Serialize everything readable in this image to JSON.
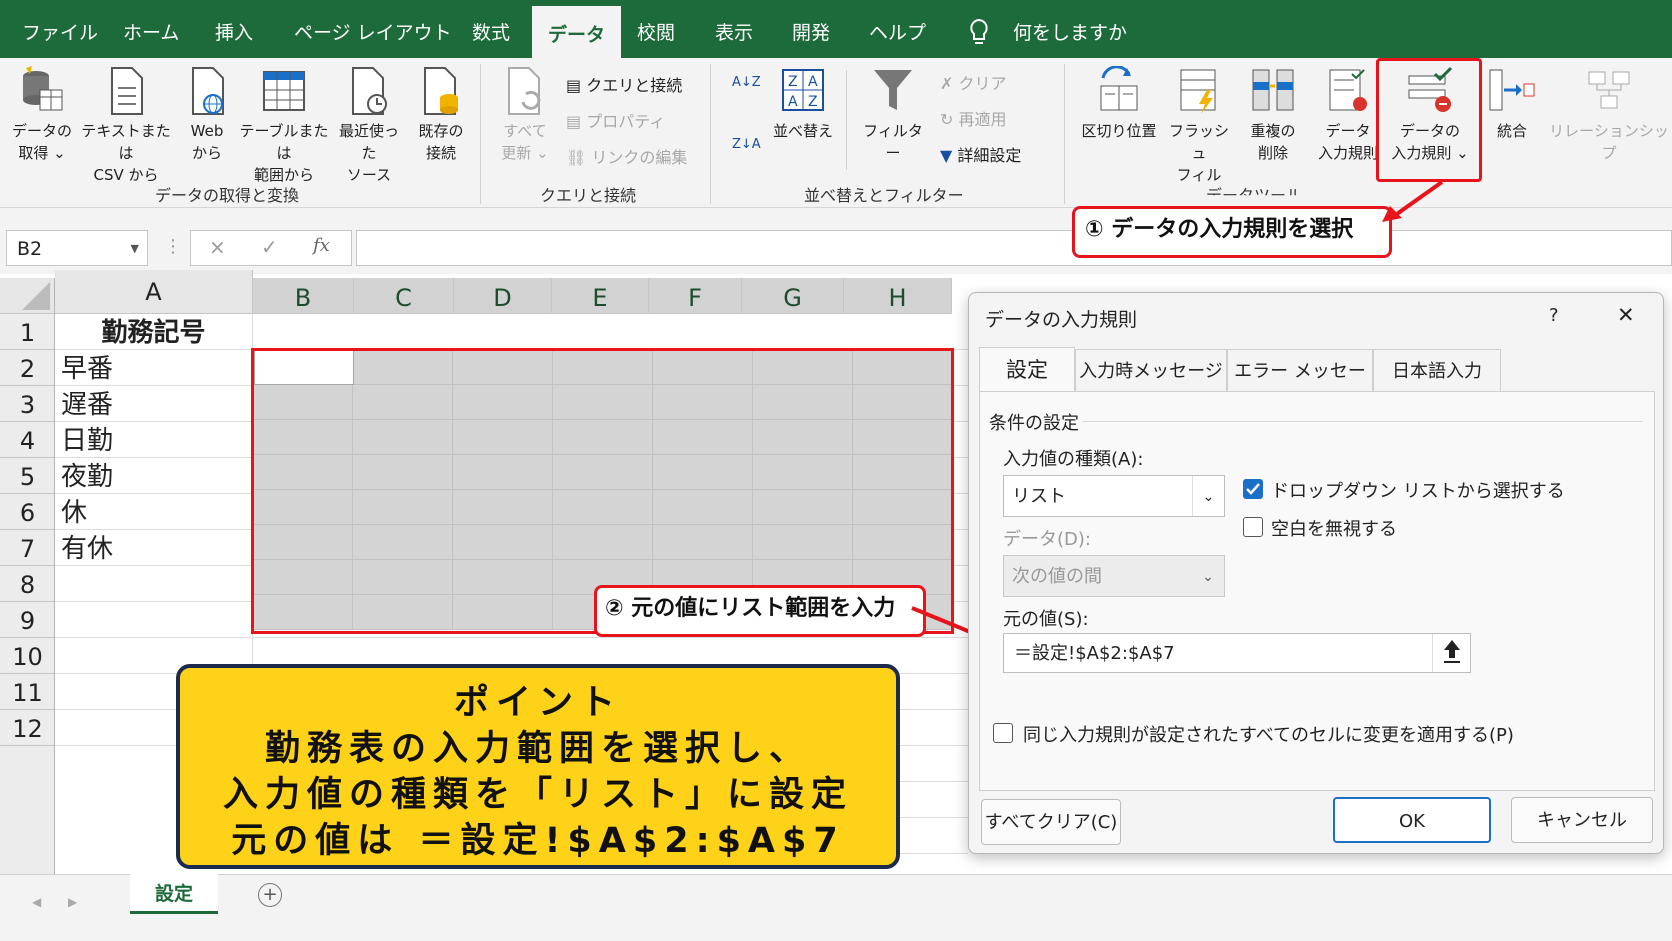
{
  "menu": {
    "tabs": [
      "ファイル",
      "ホーム",
      "挿入",
      "ページ レイアウト",
      "数式",
      "データ",
      "校閲",
      "表示",
      "開発",
      "ヘルプ"
    ],
    "active_tab": "データ",
    "tell_me": "何をしますか"
  },
  "ribbon": {
    "get_data": {
      "line1": "データの",
      "line2": "取得 ⌄"
    },
    "text_csv": {
      "line1": "テキストまたは",
      "line2": "CSV から"
    },
    "web": {
      "line1": "Web",
      "line2": "から"
    },
    "table_range": {
      "line1": "テーブルまたは",
      "line2": "範囲から"
    },
    "recent": {
      "line1": "最近使った",
      "line2": "ソース"
    },
    "existing": {
      "line1": "既存の",
      "line2": "接続"
    },
    "group1": "データの取得と変換",
    "refresh_all": {
      "line1": "すべて",
      "line2": "更新 ⌄"
    },
    "queries_conn": "クエリと接続",
    "properties": "プロパティ",
    "edit_links": "リンクの編集",
    "group2": "クエリと接続",
    "sort_az": "A↓Z",
    "sort_za": "Z↓A",
    "sort": "並べ替え",
    "filter": "フィルター",
    "clear": "クリア",
    "reapply": "再適用",
    "advanced": "詳細設定",
    "group3": "並べ替えとフィルター",
    "text_to_cols": "区切り位置",
    "flash_fill": {
      "line1": "フラッシュ",
      "line2": "フィル"
    },
    "remove_dup": {
      "line1": "重複の",
      "line2": "削除"
    },
    "data_valid_small": {
      "line1": "データ",
      "line2": "入力規則"
    },
    "data_validation": {
      "line1": "データの",
      "line2": "入力規則 ⌄"
    },
    "consolidate": "統合",
    "relationships": "リレーションシップ",
    "group4": "データツール"
  },
  "formula_bar": {
    "name_box": "B2",
    "cancel": "×",
    "enter": "✓",
    "fx": "fx"
  },
  "sheet": {
    "columns": [
      "A",
      "B",
      "C",
      "D",
      "E",
      "F",
      "G",
      "H"
    ],
    "rows": [
      "1",
      "2",
      "3",
      "4",
      "5",
      "6",
      "7",
      "8",
      "9",
      "10",
      "11",
      "12"
    ],
    "col_a": [
      "勤務記号",
      "早番",
      "遅番",
      "日勤",
      "夜勤",
      "休",
      "有休"
    ]
  },
  "callout1": "① データの入力規則を選択",
  "callout2": "② 元の値にリスト範囲を入力",
  "point": {
    "line1": "ポイント",
    "line2": "勤務表の入力範囲を選択し、",
    "line3": "入力値の種類を「リスト」に設定",
    "line4": "元の値は ＝設定!$A$2:$A$7"
  },
  "dialog": {
    "title": "データの入力規則",
    "help": "?",
    "close": "✕",
    "tabs": [
      "設定",
      "入力時メッセージ",
      "エラー メッセージ",
      "日本語入力"
    ],
    "section": "条件の設定",
    "allow_label": "入力値の種類(A):",
    "allow_value": "リスト",
    "dropdown_check": "ドロップダウン リストから選択する",
    "ignore_blank": "空白を無視する",
    "data_label": "データ(D):",
    "data_value": "次の値の間",
    "source_label": "元の値(S):",
    "source_value": "＝設定!$A$2:$A$7",
    "apply_all": "同じ入力規則が設定されたすべてのセルに変更を適用する(P)",
    "clear_all": "すべてクリア(C)",
    "ok": "OK",
    "cancel": "キャンセル"
  },
  "sheet_tab": {
    "name": "設定",
    "add": "+",
    "prev": "◀",
    "next": "▶"
  },
  "colors": {
    "excel_green": "#1d6b3a",
    "callout_red": "#e8141c",
    "point_yellow": "#ffd21a",
    "point_border": "#1c2a4d",
    "check_blue": "#1a6fc9"
  }
}
